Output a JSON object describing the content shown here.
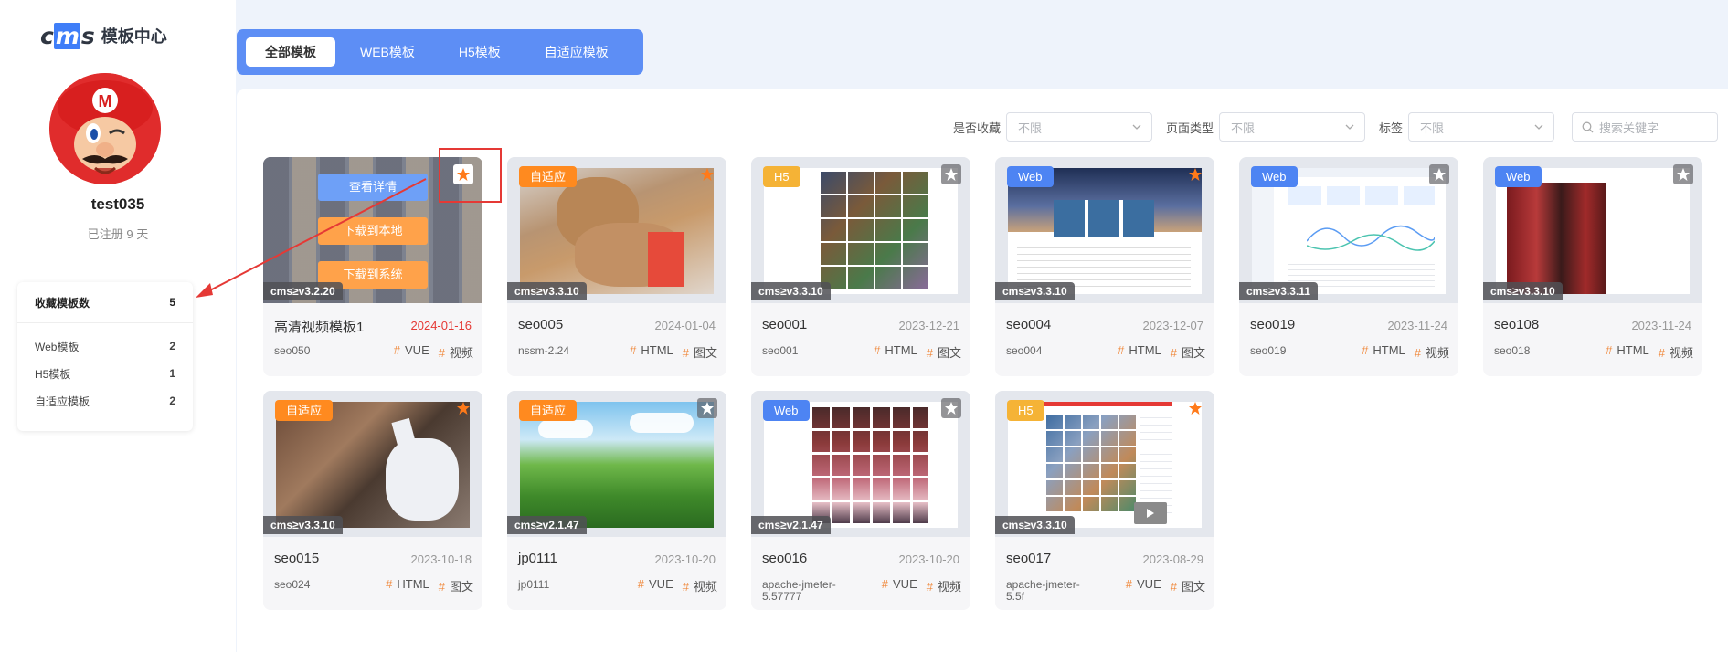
{
  "brand": {
    "logo": "cms",
    "title": "模板中心"
  },
  "user": {
    "name": "test035",
    "registered": "已注册 9 天"
  },
  "stats": {
    "title": "收藏模板数",
    "total": "5",
    "items": [
      {
        "label": "Web模板",
        "value": "2"
      },
      {
        "label": "H5模板",
        "value": "1"
      },
      {
        "label": "自适应模板",
        "value": "2"
      }
    ]
  },
  "tabs": [
    "全部模板",
    "WEB模板",
    "H5模板",
    "自适应模板"
  ],
  "filters": {
    "favorite": {
      "label": "是否收藏",
      "value": "不限"
    },
    "page_type": {
      "label": "页面类型",
      "value": "不限"
    },
    "tag": {
      "label": "标签",
      "value": "不限"
    },
    "search_placeholder": "搜索关键字"
  },
  "hover_menu": [
    "查看详情",
    "下载到本地",
    "下载到系统"
  ],
  "cards": [
    {
      "badge": "",
      "version": "cms≥v3.2.20",
      "name": "高清视频模板1",
      "date": "2024-01-16",
      "sub": "seo050",
      "tags": [
        "VUE",
        "视频"
      ],
      "starred": true
    },
    {
      "badge": "自适应",
      "version": "cms≥v3.3.10",
      "name": "seo005",
      "date": "2024-01-04",
      "sub": "nssm-2.24",
      "tags": [
        "HTML",
        "图文"
      ],
      "starred": true
    },
    {
      "badge": "H5",
      "version": "cms≥v3.3.10",
      "name": "seo001",
      "date": "2023-12-21",
      "sub": "seo001",
      "tags": [
        "HTML",
        "图文"
      ],
      "starred": false
    },
    {
      "badge": "Web",
      "version": "cms≥v3.3.10",
      "name": "seo004",
      "date": "2023-12-07",
      "sub": "seo004",
      "tags": [
        "HTML",
        "图文"
      ],
      "starred": true
    },
    {
      "badge": "Web",
      "version": "cms≥v3.3.11",
      "name": "seo019",
      "date": "2023-11-24",
      "sub": "seo019",
      "tags": [
        "HTML",
        "视频"
      ],
      "starred": false
    },
    {
      "badge": "Web",
      "version": "cms≥v3.3.10",
      "name": "seo108",
      "date": "2023-11-24",
      "sub": "seo018",
      "tags": [
        "HTML",
        "视频"
      ],
      "starred": false
    },
    {
      "badge": "自适应",
      "version": "cms≥v3.3.10",
      "name": "seo015",
      "date": "2023-10-18",
      "sub": "seo024",
      "tags": [
        "HTML",
        "图文"
      ],
      "starred": true
    },
    {
      "badge": "自适应",
      "version": "cms≥v2.1.47",
      "name": "jp0111",
      "date": "2023-10-20",
      "sub": "jp0111",
      "tags": [
        "VUE",
        "视频"
      ],
      "starred": false
    },
    {
      "badge": "Web",
      "version": "cms≥v2.1.47",
      "name": "seo016",
      "date": "2023-10-20",
      "sub": "apache-jmeter-5.57777",
      "tags": [
        "VUE",
        "视频"
      ],
      "starred": false
    },
    {
      "badge": "H5",
      "version": "cms≥v3.3.10",
      "name": "seo017",
      "date": "2023-08-29",
      "sub": "apache-jmeter-5.5f",
      "tags": [
        "VUE",
        "图文"
      ],
      "starred": true
    }
  ],
  "colors": {
    "accent": "#5d8ef5",
    "star_on": "#ff7a1a",
    "date_recent": "#e53935"
  }
}
